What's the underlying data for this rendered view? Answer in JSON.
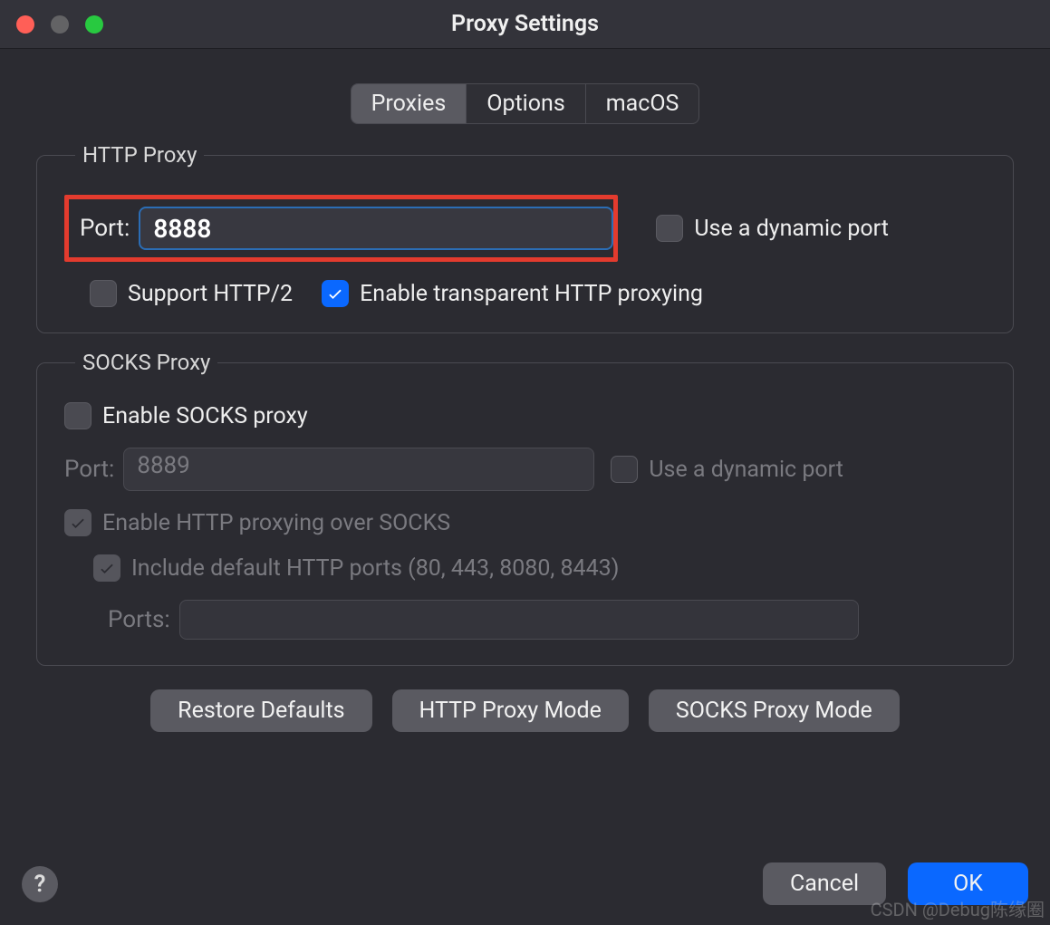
{
  "window": {
    "title": "Proxy Settings"
  },
  "tabs": {
    "proxies": "Proxies",
    "options": "Options",
    "macos": "macOS"
  },
  "http_proxy": {
    "legend": "HTTP Proxy",
    "port_label": "Port:",
    "port_value": "8888",
    "use_dynamic_port": "Use a dynamic port",
    "support_http2": "Support HTTP/2",
    "enable_transparent": "Enable transparent HTTP proxying"
  },
  "socks_proxy": {
    "legend": "SOCKS Proxy",
    "enable_socks": "Enable SOCKS proxy",
    "port_label": "Port:",
    "port_value": "8889",
    "use_dynamic_port": "Use a dynamic port",
    "enable_http_over_socks": "Enable HTTP proxying over SOCKS",
    "include_default_ports": "Include default HTTP ports (80, 443, 8080, 8443)",
    "ports_label": "Ports:",
    "ports_value": ""
  },
  "buttons": {
    "restore_defaults": "Restore Defaults",
    "http_proxy_mode": "HTTP Proxy Mode",
    "socks_proxy_mode": "SOCKS Proxy Mode",
    "cancel": "Cancel",
    "ok": "OK",
    "help": "?"
  },
  "watermark": "CSDN @Debug陈缘圈"
}
